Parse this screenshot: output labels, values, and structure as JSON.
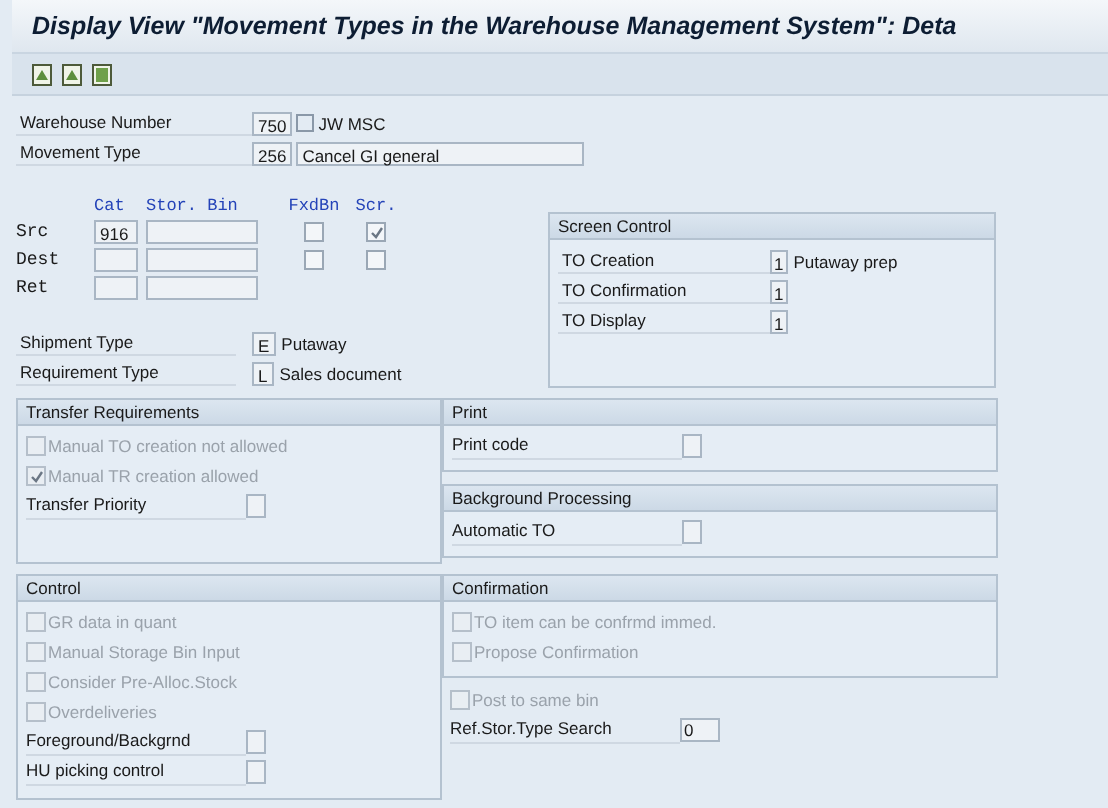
{
  "window": {
    "title": "Display View \"Movement Types in the Warehouse Management System\": Deta"
  },
  "header_fields": [
    {
      "label": "Warehouse Number",
      "value": "750",
      "description": "JW MSC",
      "kind": "text"
    },
    {
      "label": "Movement Type",
      "value": "256",
      "description": "Cancel GI general",
      "kind": "box"
    }
  ],
  "storage": {
    "columns": [
      "Cat",
      "Stor. Bin",
      "FxdBn",
      "Scr."
    ],
    "rows": [
      {
        "label": "Src",
        "cat": "916",
        "kind": "checkable",
        "fixed_bin": false,
        "screen": true
      },
      {
        "label": "Dest",
        "kind": "checkable",
        "fixed_bin": false,
        "screen": false
      },
      {
        "label": "Ret",
        "kind": "plain"
      }
    ]
  },
  "screen_control": {
    "title": "Screen Control",
    "rows": [
      {
        "label": "TO Creation",
        "value": "1",
        "description": "Putaway prep"
      },
      {
        "label": "TO Confirmation",
        "value": "1"
      },
      {
        "label": "TO Display",
        "value": "1"
      }
    ]
  },
  "type_fields": [
    {
      "label": "Shipment Type",
      "value": "E",
      "description": "Putaway"
    },
    {
      "label": "Requirement Type",
      "value": "L",
      "description": "Sales document"
    }
  ],
  "transfer_requirements": {
    "title": "Transfer Requirements",
    "items": [
      {
        "kind": "checkbox",
        "label": "Manual TO creation not allowed",
        "checked": false,
        "disabled": true
      },
      {
        "kind": "checkbox",
        "label": "Manual TR creation allowed",
        "checked": true,
        "disabled": true
      },
      {
        "kind": "field",
        "label": "Transfer Priority"
      }
    ]
  },
  "print": {
    "title": "Print",
    "items": [
      {
        "kind": "field",
        "label": "Print code"
      }
    ]
  },
  "background_processing": {
    "title": "Background Processing",
    "items": [
      {
        "kind": "field",
        "label": "Automatic TO"
      }
    ]
  },
  "control": {
    "title": "Control",
    "items": [
      {
        "kind": "checkbox",
        "label": "GR data in quant",
        "checked": false,
        "disabled": true
      },
      {
        "kind": "checkbox",
        "label": "Manual Storage Bin Input",
        "checked": false,
        "disabled": true
      },
      {
        "kind": "checkbox",
        "label": "Consider Pre-Alloc.Stock",
        "checked": false,
        "disabled": true
      },
      {
        "kind": "checkbox",
        "label": "Overdeliveries",
        "checked": false,
        "disabled": true
      },
      {
        "kind": "field",
        "label": "Foreground/Backgrnd"
      },
      {
        "kind": "field",
        "label": "HU picking control"
      }
    ]
  },
  "confirmation": {
    "title": "Confirmation",
    "items": [
      {
        "kind": "checkbox",
        "label": "TO item can be confrmd immed.",
        "checked": false,
        "disabled": true
      },
      {
        "kind": "checkbox",
        "label": "Propose Confirmation",
        "checked": false,
        "disabled": true
      }
    ]
  },
  "other": {
    "items": [
      {
        "kind": "checkbox",
        "label": "Post to same bin",
        "checked": false,
        "disabled": true
      },
      {
        "kind": "field",
        "label": "Ref.Stor.Type Search",
        "value": "0"
      }
    ]
  }
}
